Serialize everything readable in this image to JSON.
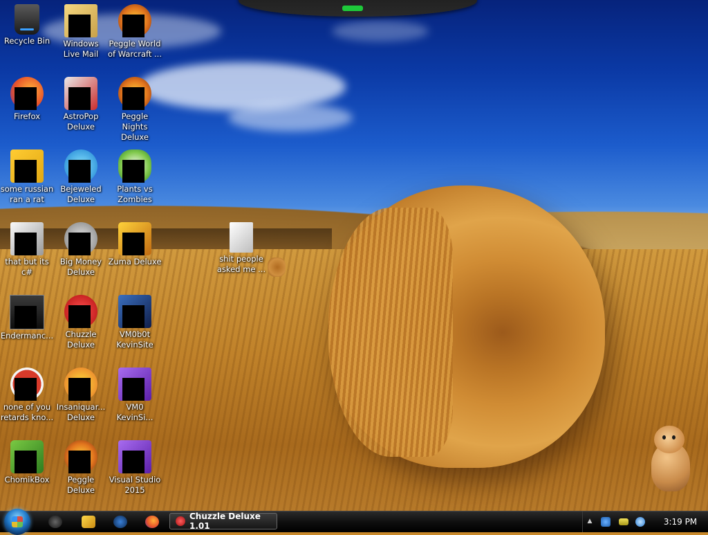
{
  "desktop": {
    "icons": [
      {
        "label": "Recycle Bin",
        "icon": "recycle-bin-icon"
      },
      {
        "label": "Windows Live Mail",
        "icon": "windows-live-mail-icon"
      },
      {
        "label": "Peggle World of Warcraft ...",
        "icon": "peggle-wow-icon"
      },
      {
        "label": "Firefox",
        "icon": "firefox-icon"
      },
      {
        "label": "AstroPop Deluxe",
        "icon": "astropop-icon"
      },
      {
        "label": "Peggle Nights Deluxe",
        "icon": "peggle-nights-icon"
      },
      {
        "label": "some russian ran a rat",
        "icon": "ie-shortcut-icon"
      },
      {
        "label": "Bejeweled Deluxe",
        "icon": "bejeweled-icon"
      },
      {
        "label": "Plants vs Zombies",
        "icon": "plants-vs-zombies-icon"
      },
      {
        "label": "that but its c#",
        "icon": "copy-shortcut-icon"
      },
      {
        "label": "Big Money Deluxe",
        "icon": "big-money-icon"
      },
      {
        "label": "Zuma Deluxe",
        "icon": "zuma-icon"
      },
      {
        "label": "Endermanc...",
        "icon": "terminal-icon"
      },
      {
        "label": "Chuzzle Deluxe",
        "icon": "chuzzle-icon"
      },
      {
        "label": "VM0b0t KevinSite",
        "icon": "vm-icon"
      },
      {
        "label": "none of you retards kno...",
        "icon": "chrome-like-icon"
      },
      {
        "label": "Insaniquar... Deluxe",
        "icon": "insaniquarium-icon"
      },
      {
        "label": "VM0 KevinSi...",
        "icon": "vm-purple-icon"
      },
      {
        "label": "ChomikBox",
        "icon": "chomikbox-icon"
      },
      {
        "label": "Peggle Deluxe",
        "icon": "peggle-icon"
      },
      {
        "label": "Visual Studio 2015",
        "icon": "visual-studio-icon"
      },
      {
        "label": "shit people asked me ...",
        "icon": "document-folder-icon"
      }
    ]
  },
  "taskbar": {
    "start_icon": "windows-start-orb-icon",
    "quick_launch": [
      "media-icon",
      "media-player-icon",
      "browser-globe-icon",
      "firefox-icon"
    ],
    "active_task": {
      "label": "Chuzzle Deluxe 1.01",
      "icon": "chuzzle-icon"
    },
    "tray": {
      "arrow": "▲",
      "icons": [
        "network-icon",
        "battery-icon",
        "volume-icon"
      ],
      "clock": "3:19 PM"
    }
  }
}
